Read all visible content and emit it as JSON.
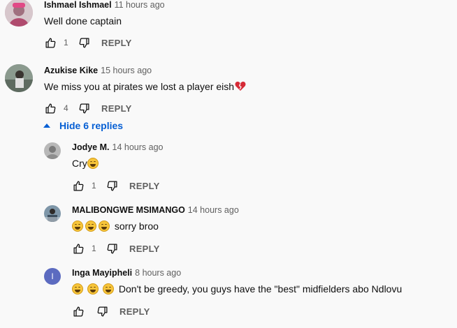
{
  "comments": [
    {
      "author": "Ishmael Ishmael",
      "time": "11 hours ago",
      "text": "Well done captain",
      "likes": "1",
      "reply_label": "REPLY",
      "avatar_color": "#c9a3b0"
    },
    {
      "author": "Azukise Kike",
      "time": "15 hours ago",
      "text": "We miss you at pirates we lost a player eish",
      "text_emoji": "broken-heart",
      "likes": "4",
      "reply_label": "REPLY",
      "avatar_color": "#7c8a8e"
    }
  ],
  "replies_toggle": {
    "label": "Hide 6 replies",
    "icon": "caret-up-icon"
  },
  "replies": [
    {
      "author": "Jodye M.",
      "time": "14 hours ago",
      "text": "Cry",
      "emojis_before": 0,
      "emojis_after": 1,
      "likes": "1",
      "reply_label": "REPLY",
      "avatar_color": "#9a9a9a"
    },
    {
      "author": "MALIBONGWE MSIMANGO",
      "time": "14 hours ago",
      "text": "sorry broo",
      "emojis_before": 3,
      "likes": "1",
      "reply_label": "REPLY",
      "avatar_color": "#6e7f8a"
    },
    {
      "author": "Inga Mayipheli",
      "time": "8 hours ago",
      "text": "Don't be greedy, you guys have the \"best\" midfielders abo Ndlovu",
      "emojis_before": 3,
      "likes": "",
      "reply_label": "REPLY",
      "avatar_letter": "I",
      "avatar_color": "#5c6bc0"
    }
  ],
  "colors": {
    "link": "#065fd4",
    "secondary_text": "#606060",
    "background": "#f9f9f9"
  }
}
